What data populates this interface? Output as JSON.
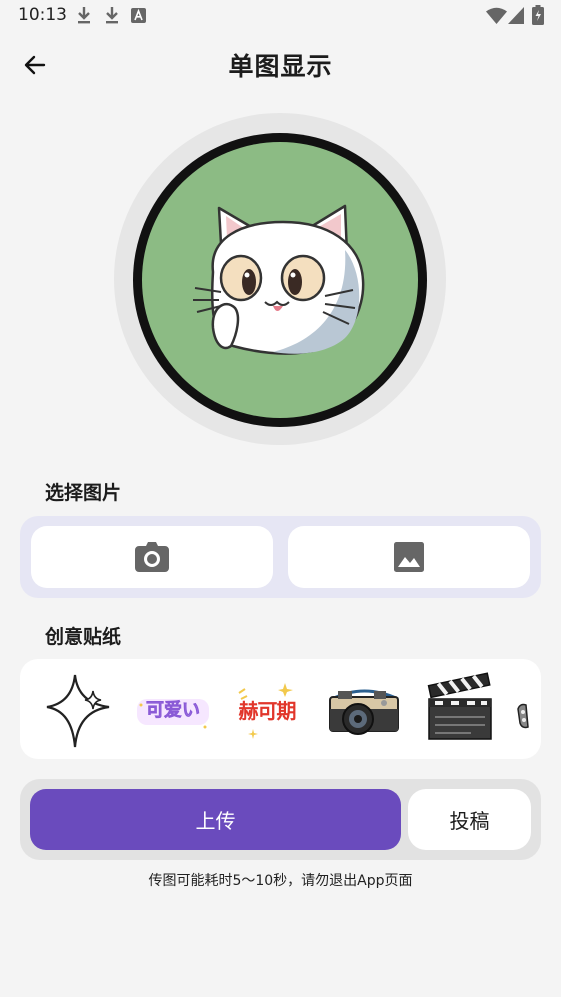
{
  "status_bar": {
    "time": "10:13"
  },
  "header": {
    "title": "单图显示"
  },
  "picker": {
    "section_title": "选择图片"
  },
  "stickers": {
    "section_title": "创意贴纸",
    "items": [
      {
        "name": "sparkle"
      },
      {
        "name": "cute",
        "text": "可爱い"
      },
      {
        "name": "looking-forward",
        "text": "赫可期"
      },
      {
        "name": "camera"
      },
      {
        "name": "clapperboard"
      }
    ]
  },
  "actions": {
    "upload_label": "上传",
    "submit_label": "投稿"
  },
  "hint": "传图可能耗时5～10秒，请勿退出App页面",
  "colors": {
    "accent": "#6a4bbd",
    "avatar_bg": "#8cbb84",
    "picker_panel": "#e6e6f4"
  }
}
